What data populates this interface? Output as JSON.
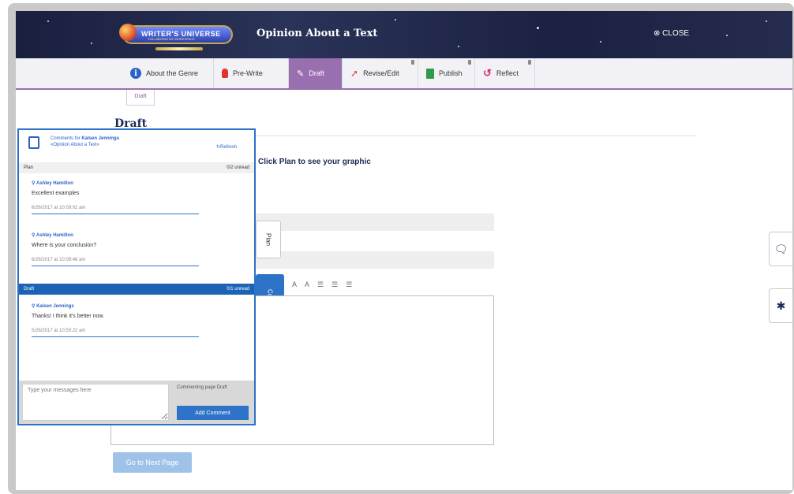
{
  "header": {
    "logo_text": "WRITER'S UNIVERSE",
    "logo_subtext": "COLLABORATIVE WORKSPACE",
    "title": "Opinion About a Text",
    "close_label": "CLOSE"
  },
  "steps": [
    {
      "label": "About the Genre",
      "icon": "info-icon",
      "active": false
    },
    {
      "label": "Pre-Write",
      "icon": "lightbulb-icon",
      "active": false
    },
    {
      "label": "Draft",
      "icon": "pencil-icon",
      "active": true
    },
    {
      "label": "Revise/Edit",
      "icon": "arrow-icon",
      "active": false
    },
    {
      "label": "Publish",
      "icon": "book-icon",
      "active": false
    },
    {
      "label": "Reflect",
      "icon": "reflect-icon",
      "active": false
    }
  ],
  "subtab": "Draft",
  "main": {
    "page_title": "Draft",
    "instruction_prefix": "Click ",
    "instruction_bold": "Plan",
    "instruction_suffix": " to see your graphic",
    "plan_tab": "Plan",
    "comments_tab": "Comments",
    "next_button": "Go to Next Page"
  },
  "comments_panel": {
    "title_prefix": "Comments for ",
    "title_name": "Kalsen Jennings",
    "subtitle": "«Opinion About a Text»",
    "refresh": "Refresh",
    "plan_section": {
      "label": "Plan",
      "unread": "0/2 unread"
    },
    "plan_comments": [
      {
        "author": "Ashley Hamilton",
        "message": "Excellent examples",
        "time": "6/26/2017 at 10:09:02 am"
      },
      {
        "author": "Ashley Hamilton",
        "message": "Where is your conclusion?",
        "time": "6/26/2017 at 10:09:46 am"
      }
    ],
    "draft_section": {
      "label": "Draft",
      "unread": "0/1 unread"
    },
    "draft_comments": [
      {
        "author": "Kalsen Jennings",
        "message": "Thanks! I think it's better now.",
        "time": "5/26/2017 at 10:50:22 am"
      }
    ],
    "message_placeholder": "Type your messages here",
    "commenting_on": "Commenting page Draft",
    "add_comment": "Add Comment"
  }
}
